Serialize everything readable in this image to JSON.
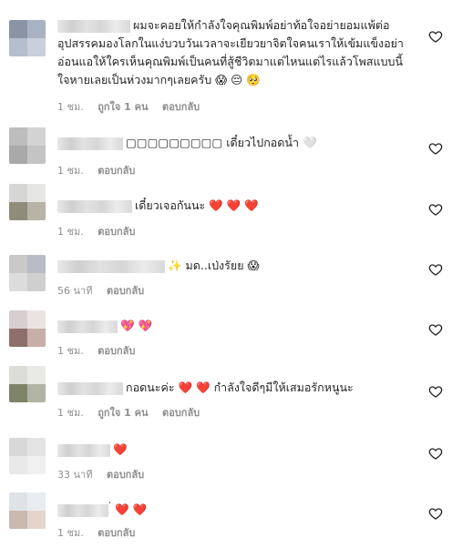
{
  "comments": [
    {
      "text": "ผมจะคอยให้กำลังใจคุณพิมพ์อย่าท้อใจอย่ายอมแพ้ต่ออุปสรรคมองโลกในแง่บวบวันเวลาจะเยียวยาจิตใจคนเราให้เข้มแข็งอย่าอ่อนแอให้ใครเห็นคุณพิมพ์เป็นคนที่สู้ชีวิตมาแต่ไหนแต่ไรแล้วโพสแบบนี้ใจหายเลยเป็นห่วงมากๆเลยครับ 😱 😔 🥺",
      "time": "1 ชม.",
      "likes": "ถูกใจ 1 คน",
      "reply": "ตอบกลับ"
    },
    {
      "text": "▢▢▢▢▢▢▢▢▢ เดี๋ยวไปกอดน้ำ 🤍",
      "time": "1 ชม.",
      "reply": "ตอบกลับ"
    },
    {
      "text": "เดี๋ยวเจอกันนะ ❤️ ❤️ ❤️",
      "time": "1 ชม.",
      "reply": "ตอบกลับ"
    },
    {
      "text": "✨ มด..เป่งรัยย 😱",
      "time": "56 นาที",
      "reply": "ตอบกลับ"
    },
    {
      "text": "💖 💖",
      "time": "1 ชม.",
      "reply": "ตอบกลับ"
    },
    {
      "text": "กอดนะค่ะ ❤️ ❤️ กำลังใจดีๆมีให้เสมอรักหนูนะ",
      "time": "1 ชม.",
      "likes": "ถูกใจ 1 คน",
      "reply": "ตอบกลับ"
    },
    {
      "text": "❤️",
      "time": "33 นาที",
      "reply": "ตอบกลับ"
    },
    {
      "text": "่ ❤️ ❤️",
      "time": "1 ชม.",
      "reply": "ตอบกลับ"
    }
  ],
  "icons": {
    "like": "heart-outline-icon"
  },
  "colors": {
    "meta": "#8e8e8e",
    "text": "#262626",
    "heart": "#ed4956"
  }
}
